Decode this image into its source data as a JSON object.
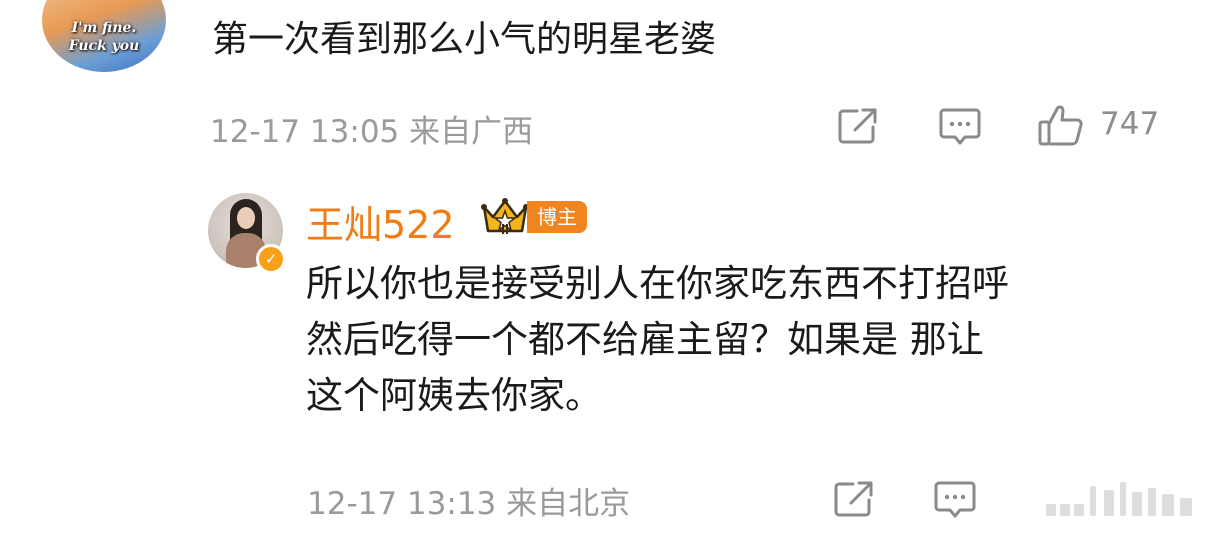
{
  "comment1": {
    "avatar": {
      "caption_line1": "I'm fine.",
      "caption_line2": "Fuck you"
    },
    "text": "第一次看到那么小气的明星老婆",
    "timestamp": "12-17 13:05",
    "location": "来自广西",
    "like_count": "747"
  },
  "reply": {
    "username": "王灿522",
    "badge": "博主",
    "text_lines": [
      "所以你也是接受别人在你家吃东西不打招呼",
      "然后吃得一个都不给雇主留？如果是 那让",
      "这个阿姨去你家。"
    ],
    "timestamp": "12-17 13:13",
    "location": "来自北京"
  },
  "icons": {
    "share": "share-icon",
    "comment": "comment-icon",
    "like": "thumbs-up-icon",
    "verified": "verified-badge-icon",
    "crown": "crown-badge-icon"
  },
  "colors": {
    "username": "#f07c13",
    "badge_bg": "#f0841e",
    "meta": "#9a9a9a",
    "verified": "#f7a018"
  }
}
